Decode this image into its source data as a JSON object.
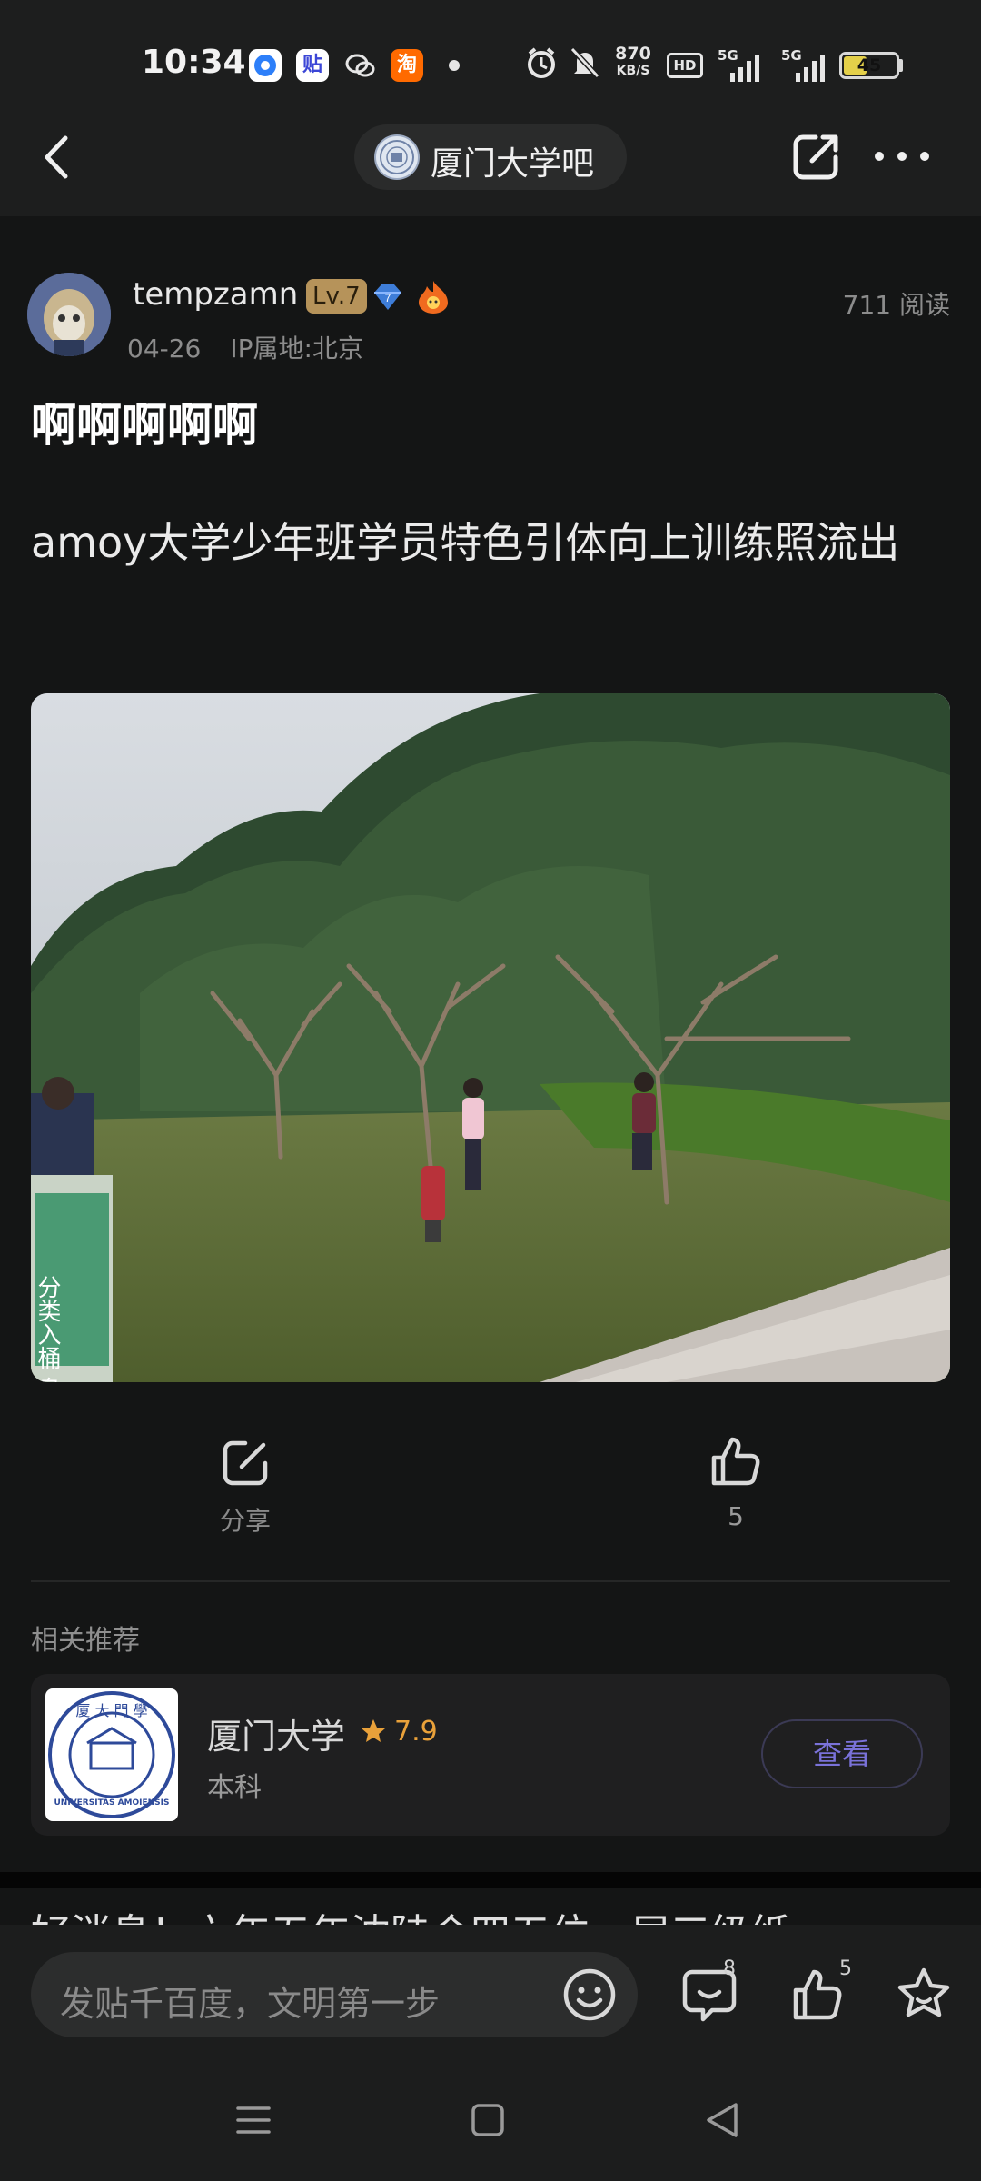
{
  "status_bar": {
    "time": "10:34",
    "apps": [
      "browser-icon",
      "tieba-icon",
      "wechat-icon",
      "taobao-icon"
    ],
    "tieba_label": "贴",
    "taobao_label": "淘",
    "speed_value": "870",
    "speed_unit": "KB/S",
    "hd_label": "HD",
    "net1": "5G",
    "net2": "5G",
    "battery": "45",
    "battery_level": 0.45,
    "battery_color": "#e4d04a"
  },
  "nav": {
    "forum_name": "厦门大学吧"
  },
  "post": {
    "author": "tempzamn",
    "level": "Lv.7",
    "gem_level": "7",
    "reads": "711 阅读",
    "date": "04-26",
    "ip": "IP属地:北京",
    "title": "啊啊啊啊啊",
    "body": "amoy大学少年班学员特色引体向上训练照流出",
    "photo_sign_text": "分类入桶  鸟语花香"
  },
  "actions": {
    "share_label": "分享",
    "like_count": "5"
  },
  "recommend": {
    "section_title": "相关推荐",
    "name": "厦门大学",
    "rating": "7.9",
    "sub": "本科",
    "button": "查看",
    "logo_top_text": "厦 大 門 學",
    "logo_ring_text": "UNIVERSITAS AMOIENSIS",
    "accent": "#7a72d9",
    "star_color": "#e9a13a"
  },
  "next_post_peek": "好消息！六年五年沈陆合四五位一届三级纸",
  "bottom_bar": {
    "placeholder": "发贴千百度，文明第一步",
    "comment_count": "8",
    "like_count": "5"
  }
}
